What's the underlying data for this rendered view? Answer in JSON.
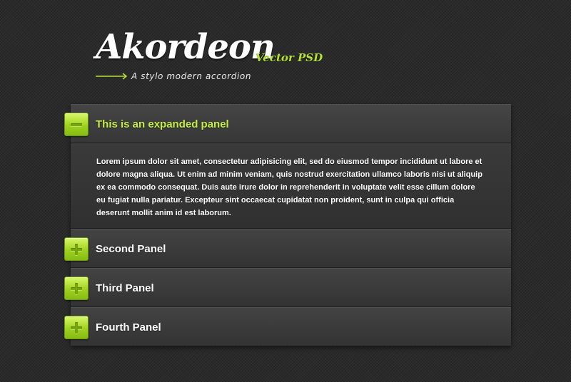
{
  "header": {
    "title": "Akordeon",
    "badge": "Vector PSD",
    "tagline": "A stylo modern accordion"
  },
  "colors": {
    "accent": "#b6e234",
    "background": "#2b2b2b",
    "panel": "#3a3a3a"
  },
  "accordion": {
    "panels": [
      {
        "title": "This is an expanded panel",
        "expanded": true,
        "icon": "minus-icon",
        "content": "Lorem ipsum dolor sit amet, consectetur adipisicing elit, sed do eiusmod tempor incididunt ut labore et dolore magna aliqua. Ut enim ad minim veniam, quis nostrud exercitation ullamco laboris nisi ut aliquip ex ea commodo consequat. Duis aute irure dolor in reprehenderit in voluptate velit esse cillum dolore eu fugiat nulla pariatur. Excepteur sint occaecat cupidatat non proident, sunt in culpa qui officia deserunt mollit anim id est laborum."
      },
      {
        "title": "Second Panel",
        "expanded": false,
        "icon": "plus-icon"
      },
      {
        "title": "Third Panel",
        "expanded": false,
        "icon": "plus-icon"
      },
      {
        "title": "Fourth Panel",
        "expanded": false,
        "icon": "plus-icon"
      }
    ]
  }
}
